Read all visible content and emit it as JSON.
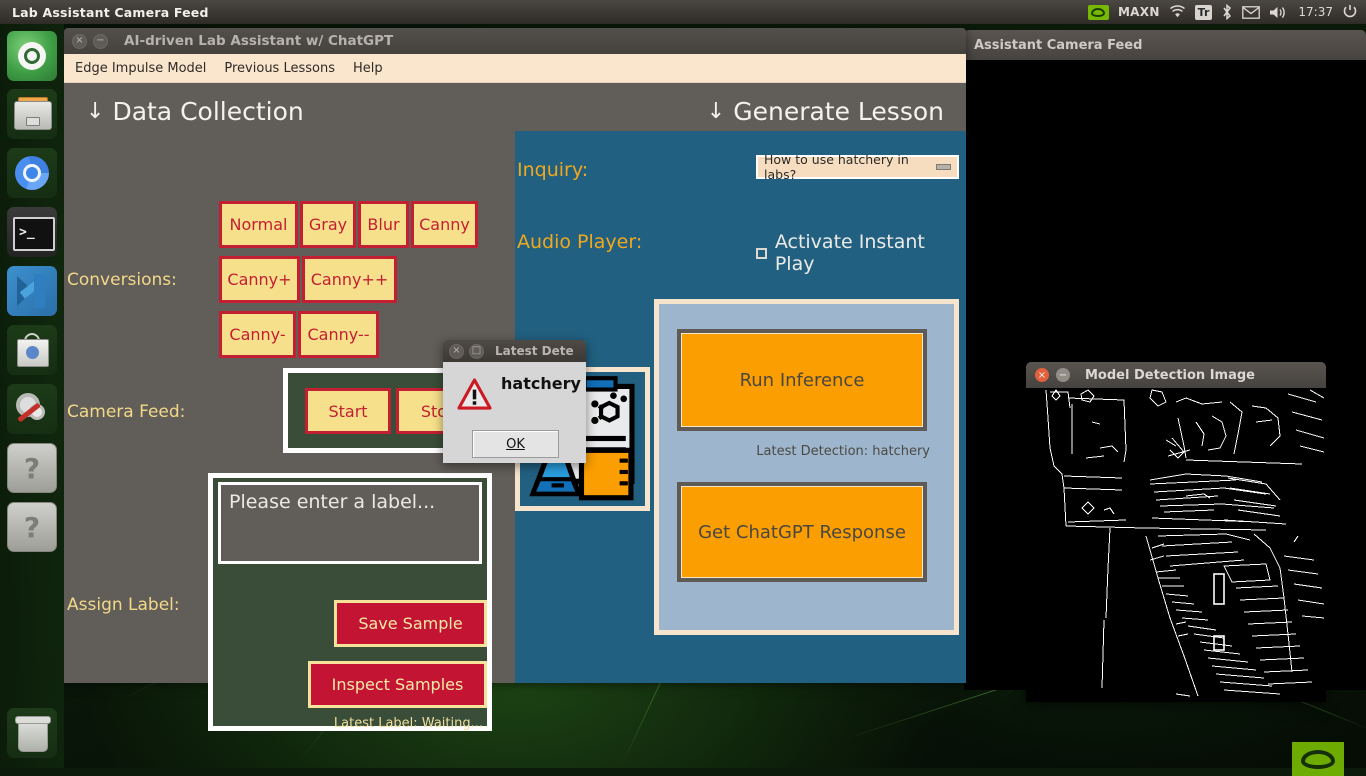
{
  "top_panel": {
    "window_title": "Lab Assistant Camera Feed",
    "tray": {
      "gpu_label": "MAXN",
      "keyboard_layout": "Tr",
      "clock": "17:37",
      "icons": [
        "nvidia-icon",
        "wifi-icon",
        "bluetooth-icon",
        "mail-icon",
        "volume-icon",
        "power-gear-icon"
      ]
    }
  },
  "launcher": {
    "items": [
      {
        "name": "ubuntu-dash-icon",
        "label": "Ubuntu Dash"
      },
      {
        "name": "files-icon",
        "label": "Files"
      },
      {
        "name": "chromium-icon",
        "label": "Chromium"
      },
      {
        "name": "terminal-icon",
        "label": "Terminal"
      },
      {
        "name": "vscode-icon",
        "label": "Visual Studio Code"
      },
      {
        "name": "software-center-icon",
        "label": "Ubuntu Software"
      },
      {
        "name": "system-tools-icon",
        "label": "System Tools"
      },
      {
        "name": "unknown-app-icon-1",
        "label": "Unknown Application"
      },
      {
        "name": "unknown-app-icon-2",
        "label": "Unknown Application"
      }
    ],
    "trash_label": "Trash"
  },
  "camera_feed_window": {
    "title": "Assistant Camera Feed"
  },
  "app_window": {
    "title": "AI-driven Lab Assistant w/ ChatGPT",
    "menu": [
      "Edge Impulse Model",
      "Previous Lessons",
      "Help"
    ],
    "left": {
      "heading": "Data Collection",
      "heading_arrow": "↓",
      "conversions_label": "Conversions:",
      "conversion_buttons_row1": [
        "Normal",
        "Gray",
        "Blur",
        "Canny"
      ],
      "conversion_buttons_row2": [
        "Canny+",
        "Canny++"
      ],
      "conversion_buttons_row3": [
        "Canny-",
        "Canny--"
      ],
      "camera_feed_label": "Camera Feed:",
      "camera_buttons": [
        "Start",
        "Stop"
      ],
      "assign_label": "Assign Label:",
      "label_input_placeholder": "Please enter a label...",
      "label_input_value": "",
      "save_sample_button": "Save Sample",
      "inspect_samples_button": "Inspect Samples",
      "latest_label_status": "Latest Label: Waiting..."
    },
    "right": {
      "heading": "Generate Lesson",
      "heading_arrow": "↓",
      "inquiry_label": "Inquiry:",
      "inquiry_selected": "How to use hatchery in labs?",
      "audio_player_label": "Audio Player:",
      "instant_play_checkbox": "Activate Instant Play",
      "instant_play_checked": false,
      "run_inference_button": "Run Inference",
      "latest_detection_status": "Latest Detection: hatchery",
      "chatgpt_button": "Get ChatGPT Response",
      "lab_image_name": "lab-science-illustration"
    }
  },
  "dialog": {
    "title": "Latest Dete",
    "message": "hatchery",
    "ok_button": "OK",
    "icon": "warning-triangle-icon"
  },
  "detection_window": {
    "title": "Model Detection Image",
    "content": "canny-edge-detection-output"
  },
  "colors": {
    "accent_yellow_button": "#f7e08b",
    "accent_red_border": "#c21f33",
    "red_button": "#c31533",
    "blue_panel": "#226081",
    "orange_button": "#fa9e02",
    "orange_label": "#f0a81c",
    "light_panel": "#9db6cd",
    "window_body": "#615d58",
    "green_frame": "#3a4d38",
    "menubar": "#fae6cd"
  }
}
